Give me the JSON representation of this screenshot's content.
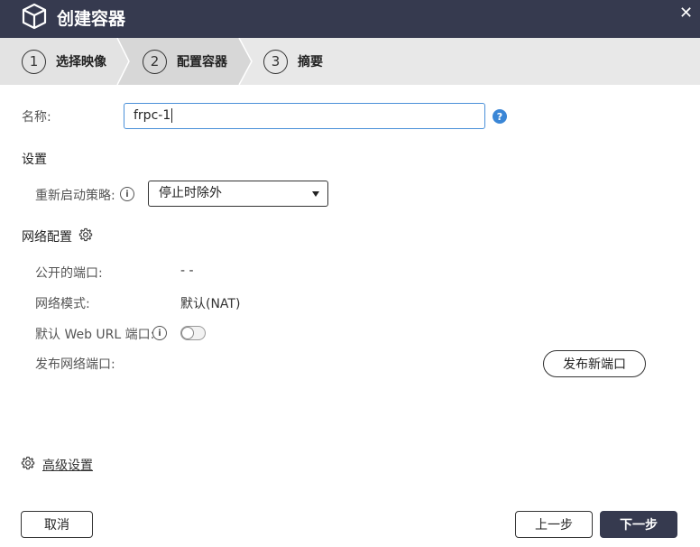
{
  "window": {
    "title": "创建容器",
    "close_icon": "✕",
    "colors": {
      "titlebar": "#363a4f",
      "accent": "#3a86d6"
    }
  },
  "steps": [
    {
      "number": "1",
      "label": "选择映像"
    },
    {
      "number": "2",
      "label": "配置容器"
    },
    {
      "number": "3",
      "label": "摘要"
    }
  ],
  "form": {
    "name_label": "名称:",
    "name_value": "frpc-1",
    "help_icon": "?",
    "settings_title": "设置",
    "restart_label": "重新启动策略:",
    "restart_value": "停止时除外",
    "network_title": "网络配置",
    "public_ports_label": "公开的端口:",
    "public_ports_value": "- -",
    "network_mode_label": "网络模式:",
    "network_mode_value": "默认(NAT)",
    "default_web_url_label": "默认 Web URL 端口:",
    "default_web_url_enabled": false,
    "publish_port_label": "发布网络端口:",
    "publish_new_port_button": "发布新端口",
    "info_icon": "i"
  },
  "advanced": {
    "label": "高级设置"
  },
  "footer": {
    "cancel": "取消",
    "prev": "上一步",
    "next": "下一步"
  }
}
